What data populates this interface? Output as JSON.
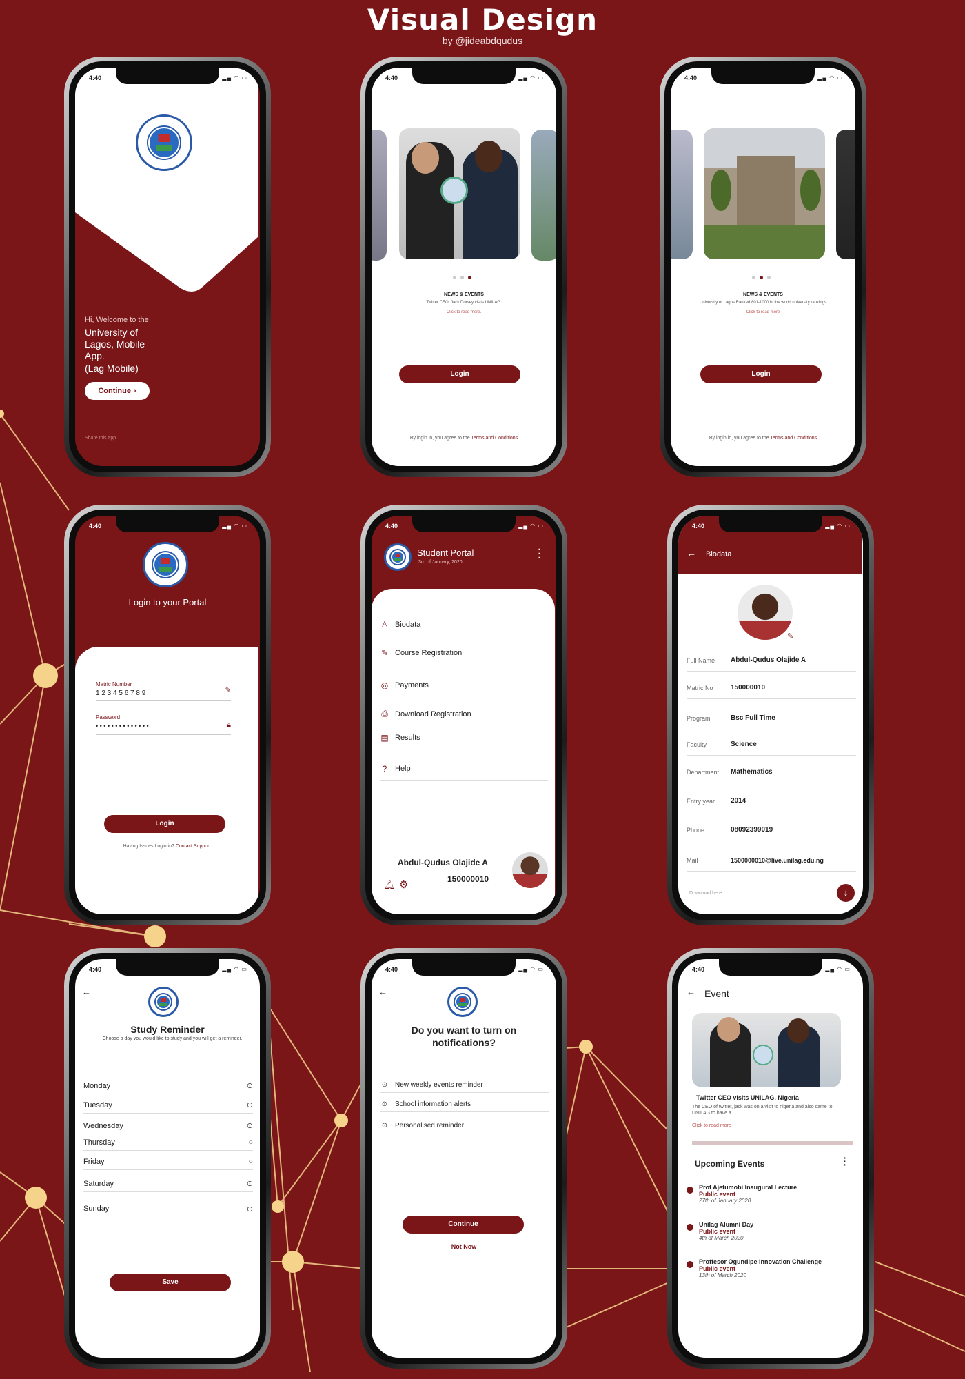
{
  "header": {
    "title": "Visual Design",
    "byline": "by @jideabdqudus"
  },
  "status": {
    "time": "4:40",
    "icons": "▂▄ ◠ ▭"
  },
  "screen1": {
    "greeting": "Hi, Welcome to the",
    "app_name": "University of Lagos, Mobile App.",
    "app_short": "(Lag Mobile)",
    "continue": "Continue",
    "share": "Share this app"
  },
  "screen2": {
    "news_label": "NEWS & EVENTS",
    "news_text": "Twitter CEO, Jack Dorsey visits UNILAG.",
    "read_more": "Click to read more.",
    "login": "Login",
    "terms_prefix": "By login in, you agree to the ",
    "terms_link": "Terms and Conditions"
  },
  "screen3": {
    "news_label": "NEWS & EVENTS",
    "news_text": "University of Lagos Ranked 801-1000 in the world university rankings",
    "read_more": "Click to read more",
    "login": "Login",
    "terms_prefix": "By login in, you agree to the ",
    "terms_link": "Terms and Conditions"
  },
  "screen4": {
    "title": "Login to your Portal",
    "matric_label": "Matric Number",
    "matric_value": "1 2 3 4 5 6 7 8 9",
    "password_label": "Password",
    "password_value": "• • • • • • • • • • • • • •",
    "login": "Login",
    "support_prefix": "Having Issues Login in? ",
    "support_link": "Contact Support"
  },
  "screen5": {
    "title": "Student Portal",
    "date": "3rd of January, 2020.",
    "menu": [
      "Biodata",
      "Course Registration",
      "Payments",
      "Download Registration",
      "Results",
      "Help"
    ],
    "name": "Abdul-Qudus Olajide A",
    "matric": "150000010"
  },
  "screen6": {
    "title": "Biodata",
    "rows": [
      {
        "label": "Full Name",
        "value": "Abdul-Qudus Olajide A"
      },
      {
        "label": "Matric No",
        "value": "150000010"
      },
      {
        "label": "Program",
        "value": "Bsc Full Time"
      },
      {
        "label": "Faculty",
        "value": "Science"
      },
      {
        "label": "Department",
        "value": "Mathematics"
      },
      {
        "label": "Entry year",
        "value": "2014"
      },
      {
        "label": "Phone",
        "value": "08092399019"
      },
      {
        "label": "Mail",
        "value": "1500000010@live.unilag.edu.ng"
      }
    ],
    "download": "Download here"
  },
  "screen7": {
    "title": "Study Reminder",
    "subtitle": "Choose a day you would like to study and you will get a reminder.",
    "days": [
      {
        "day": "Monday",
        "on": true
      },
      {
        "day": "Tuesday",
        "on": true
      },
      {
        "day": "Wednesday",
        "on": true
      },
      {
        "day": "Thursday",
        "on": false
      },
      {
        "day": "Friday",
        "on": false
      },
      {
        "day": "Saturday",
        "on": true
      },
      {
        "day": "Sunday",
        "on": true
      }
    ],
    "save": "Save"
  },
  "screen8": {
    "title": "Do you want to turn on notifications?",
    "options": [
      "New weekly events reminder",
      "School information alerts",
      "Personalised reminder"
    ],
    "continue": "Continue",
    "not_now": "Not Now"
  },
  "screen9": {
    "title": "Event",
    "event_title": "Twitter CEO visits UNILAG, Nigeria",
    "event_text": "The CEO of twitter, jack was on a visit to nigeria and also came to UNILAG to have a.......",
    "read_more": "Click to read more",
    "upcoming": "Upcoming Events",
    "events": [
      {
        "name": "Prof Ajetumobi Inaugural Lecture",
        "type": "Public event",
        "date": "27th of January 2020"
      },
      {
        "name": "Unilag Alumni Day",
        "type": "Public event",
        "date": "4th of March 2020"
      },
      {
        "name": "Proffesor Ogundipe Innovation Challenge",
        "type": "Public event",
        "date": "13th of March 2020"
      }
    ]
  },
  "colors": {
    "primary": "#7a1518",
    "accent": "#f5d38a"
  }
}
